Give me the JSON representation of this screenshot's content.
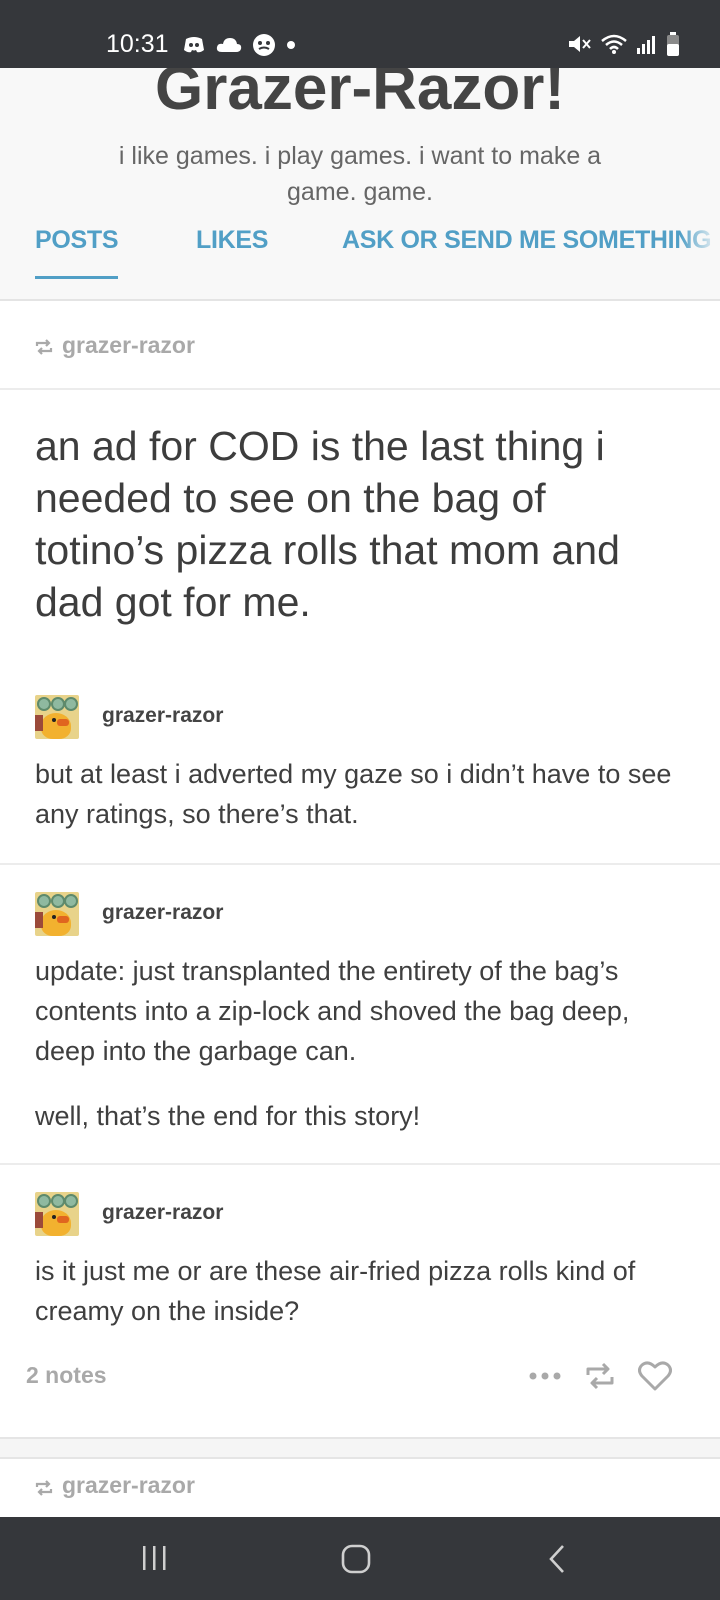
{
  "status_bar": {
    "time": "10:31",
    "left_icons": [
      "discord-icon",
      "cloud-icon",
      "emoji-app-icon",
      "dot-icon"
    ],
    "right_icons": [
      "mute-vibrate-icon",
      "wifi-icon",
      "signal-icon",
      "battery-icon"
    ]
  },
  "blog": {
    "title": "Grazer-Razor!",
    "description": "i like games. i play games. i want to make a game. game.",
    "tabs": [
      {
        "label": "POSTS",
        "active": true
      },
      {
        "label": "LIKES",
        "active": false
      },
      {
        "label": "ASK OR SEND ME SOMETHING",
        "active": false
      }
    ],
    "accent_color": "#519fc6"
  },
  "post": {
    "reblogged_from": "grazer-razor",
    "title": "an ad for COD is the last thing i needed to see on the bag of totino’s pizza rolls that mom and dad got for me.",
    "trail": [
      {
        "username": "grazer-razor",
        "paragraphs": [
          "but at least i adverted my gaze so i didn’t have to see any ratings, so there’s that."
        ]
      },
      {
        "username": "grazer-razor",
        "paragraphs": [
          "update: just transplanted the entirety of the bag’s contents into a zip-lock and shoved the bag deep, deep into the garbage can.",
          "well, that’s the end for this story!"
        ]
      },
      {
        "username": "grazer-razor",
        "paragraphs": [
          "is it just me or are these air-fried pizza rolls kind of creamy on the inside?"
        ]
      }
    ],
    "notes": "2 notes",
    "actions": [
      "more-icon",
      "reblog-icon",
      "heart-icon"
    ]
  },
  "next_post": {
    "reblogged_from": "grazer-razor"
  },
  "nav_bar": {
    "buttons": [
      "recents-icon",
      "home-icon",
      "back-icon"
    ]
  }
}
